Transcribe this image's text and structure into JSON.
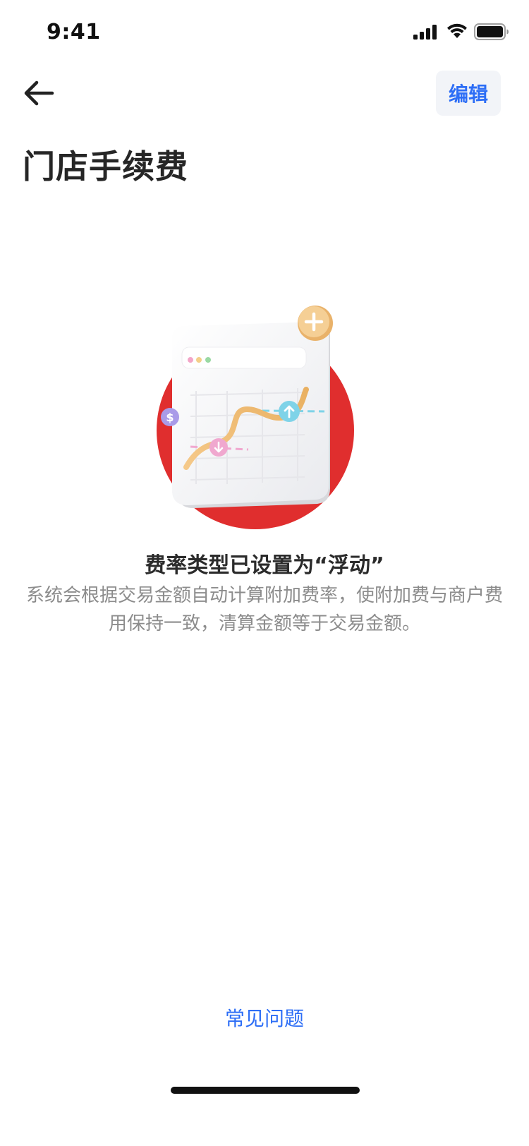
{
  "status_bar": {
    "time": "9:41",
    "signal_icon": "cellular-signal-icon",
    "wifi_icon": "wifi-icon",
    "battery_icon": "battery-icon"
  },
  "nav": {
    "back_icon": "arrow-left-icon",
    "edit_label": "编辑"
  },
  "page": {
    "title": "门店手续费"
  },
  "illustration": {
    "name": "floating-rate-chart-illustration",
    "accent_color": "#e02e2e",
    "curve_color": "#f0c07a",
    "up_badge_color": "#7fd3e8",
    "down_badge_color": "#f0a8cf",
    "dollar_badge_color": "#a99be8",
    "plus_badge_color": "#f2c98a"
  },
  "info": {
    "title": "费率类型已设置为“浮动”",
    "description": "系统会根据交易金额自动计算附加费率，使附加费与商户费用保持一致，清算金额等于交易金额。"
  },
  "footer": {
    "faq_label": "常见问题"
  },
  "colors": {
    "link_blue": "#2d6ef6",
    "title_text": "#262626",
    "desc_text": "#8c8c8c",
    "edit_bg": "#f2f4f8"
  }
}
